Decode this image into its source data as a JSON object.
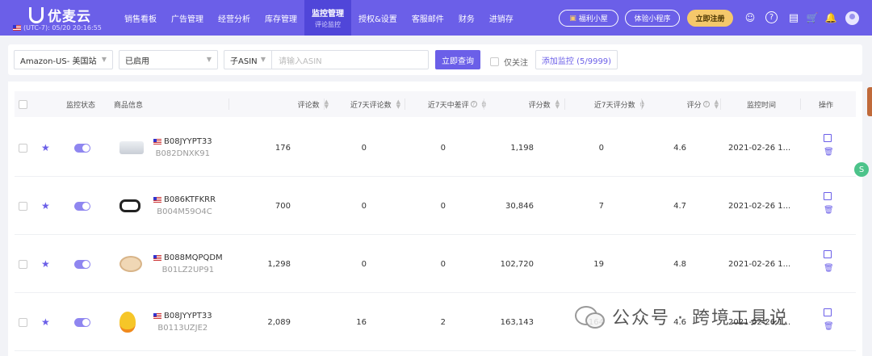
{
  "brand": {
    "name": "优麦云",
    "timezone": "(UTC-7): 05/20 20:16:55"
  },
  "nav": [
    {
      "label": "销售看板"
    },
    {
      "label": "广告管理"
    },
    {
      "label": "经营分析"
    },
    {
      "label": "库存管理"
    },
    {
      "label": "监控管理",
      "sub": "评论监控",
      "active": true
    },
    {
      "label": "授权&设置"
    },
    {
      "label": "客服邮件"
    },
    {
      "label": "财务"
    },
    {
      "label": "进销存"
    }
  ],
  "top_actions": {
    "welfare": "福利小屋",
    "miniprogram": "体验小程序",
    "register": "立即注册"
  },
  "filters": {
    "marketplace": "Amazon-US- 美国站",
    "status": "已启用",
    "asin_type": "子ASIN",
    "asin_placeholder": "请输入ASIN",
    "query_button": "立即查询",
    "only_follow": "仅关注",
    "add_monitor": "添加监控 (5/9999)"
  },
  "table": {
    "headers": {
      "status": "监控状态",
      "product": "商品信息",
      "reviews": "评论数",
      "reviews7": "近7天评论数",
      "bad7": "近7天中差评",
      "ratings": "评分数",
      "ratings7": "近7天评分数",
      "score": "评分",
      "time": "监控时间",
      "ops": "操作"
    },
    "rows": [
      {
        "asin": "B08JYYPT33",
        "parent": "B082DNXK91",
        "reviews": "176",
        "reviews7": "0",
        "bad7": "0",
        "ratings": "1,198",
        "ratings7": "0",
        "score": "4.6",
        "time": "2021-02-26 1..."
      },
      {
        "asin": "B086KTFKRR",
        "parent": "B004M59O4C",
        "reviews": "700",
        "reviews7": "0",
        "bad7": "0",
        "ratings": "30,846",
        "ratings7": "7",
        "score": "4.7",
        "time": "2021-02-26 1..."
      },
      {
        "asin": "B088MQPQDM",
        "parent": "B01LZ2UP91",
        "reviews": "1,298",
        "reviews7": "0",
        "bad7": "0",
        "ratings": "102,720",
        "ratings7": "19",
        "score": "4.8",
        "time": "2021-02-26 1..."
      },
      {
        "asin": "B08JYYPT33",
        "parent": "B0113UZJE2",
        "reviews": "2,089",
        "reviews7": "16",
        "bad7": "2",
        "ratings": "163,143",
        "ratings7": "164",
        "score": "4.6",
        "time": "2021-02-26 1..."
      }
    ]
  },
  "watermark": "公众号 · 跨境工具说",
  "colors": {
    "primary": "#6b5fe8",
    "gold": "#f5c86b"
  }
}
